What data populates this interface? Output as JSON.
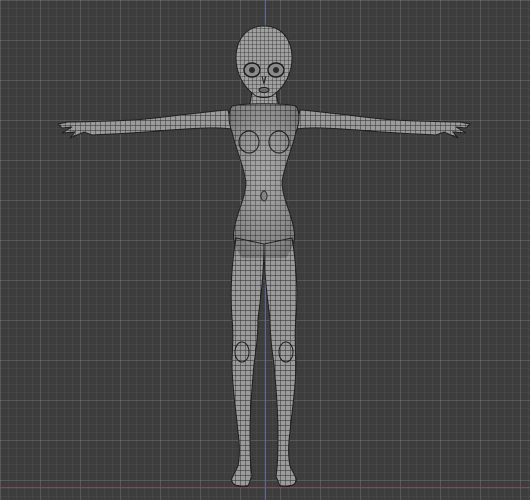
{
  "viewport": {
    "background_color": "#3d3d3d",
    "grid_color": "#4d4d4d",
    "axis_vertical_color": "#5b6fa6",
    "axis_horizontal_color": "#8a4f56"
  },
  "model": {
    "kind": "wireframe-female-base-mesh",
    "pose": "T-pose",
    "shading": "solid-with-wireframe",
    "mesh_color": "#9a9a9a",
    "wire_color": "#1f1f1f"
  }
}
